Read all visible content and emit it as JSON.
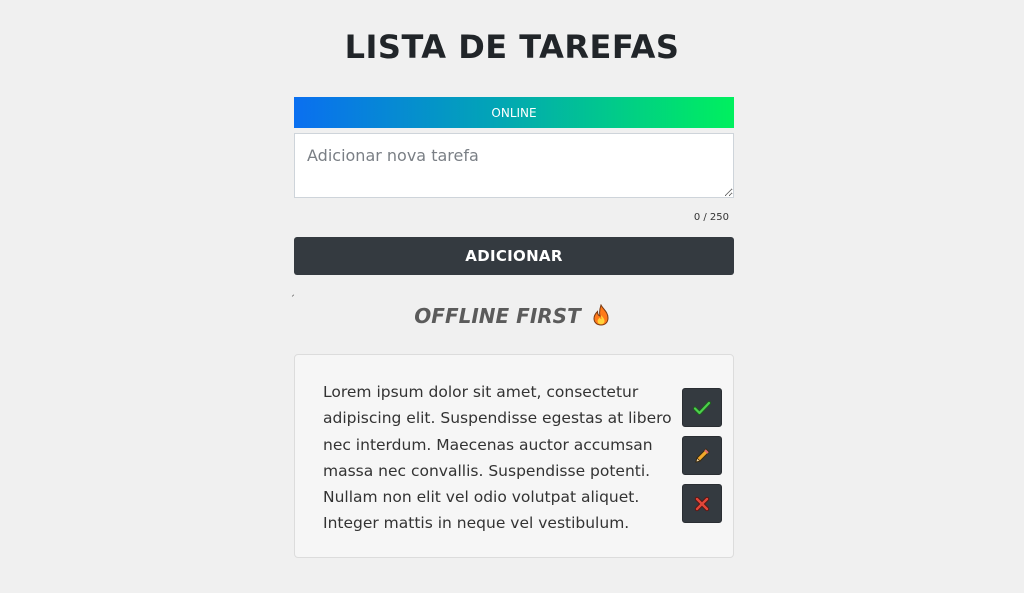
{
  "header": {
    "title": "LISTA DE TAREFAS"
  },
  "status": {
    "label": "ONLINE",
    "colors": [
      "#0a6ff0",
      "#00f05e"
    ]
  },
  "task_input": {
    "value": "",
    "placeholder": "Adicionar nova tarefa"
  },
  "counter": {
    "text": "0 / 250"
  },
  "add_button": {
    "label": "ADICIONAR"
  },
  "section": {
    "title": "OFFLINE FIRST",
    "icon": "fire-icon"
  },
  "tasks": [
    {
      "text": "Lorem ipsum dolor sit amet, consectetur adipiscing elit. Suspendisse egestas at libero nec interdum. Maecenas auctor accumsan massa nec convallis. Suspendisse potenti. Nullam non elit vel odio volutpat aliquet. Integer mattis in neque vel vestibulum.",
      "actions": [
        "check-icon",
        "pencil-icon",
        "close-icon"
      ]
    }
  ],
  "colors": {
    "button_dark": "#343a40",
    "check": "#3fbf3f",
    "delete": "#d63a2f",
    "pencil": "#f2a82a"
  }
}
